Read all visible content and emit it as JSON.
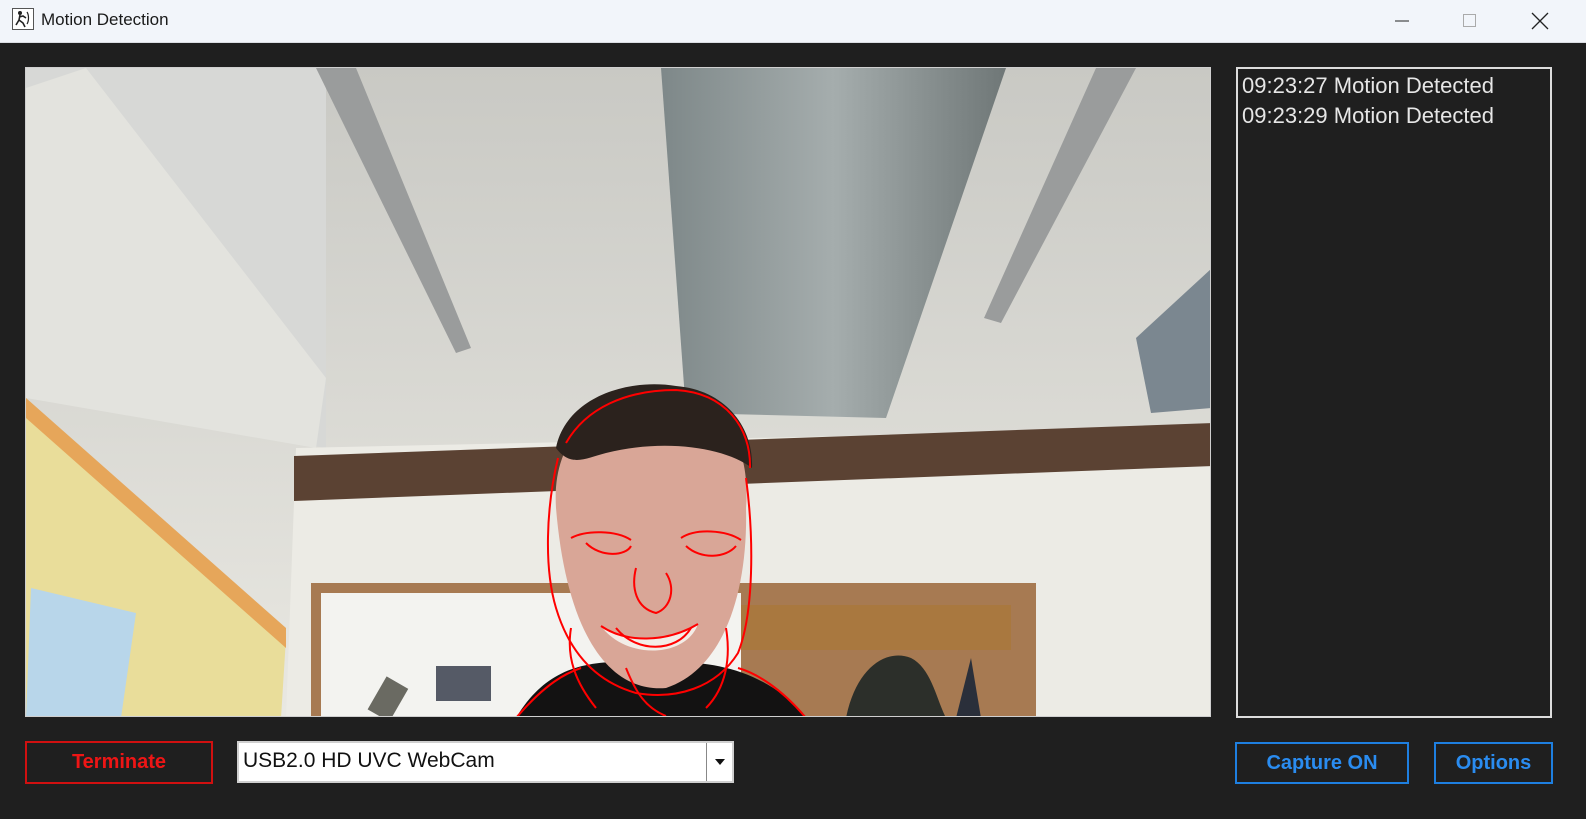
{
  "window": {
    "title": "Motion Detection",
    "icon": "motion-app-icon"
  },
  "log": {
    "entries": [
      "09:23:27 Motion Detected",
      "09:23:29 Motion Detected"
    ]
  },
  "controls": {
    "terminate_label": "Terminate",
    "camera_selected": "USB2.0 HD UVC WebCam",
    "capture_label": "Capture ON",
    "options_label": "Options"
  },
  "colors": {
    "background": "#1f1f1f",
    "terminate": "#ee1515",
    "accent": "#2a8cf0",
    "motion_outline": "#ff0000"
  }
}
